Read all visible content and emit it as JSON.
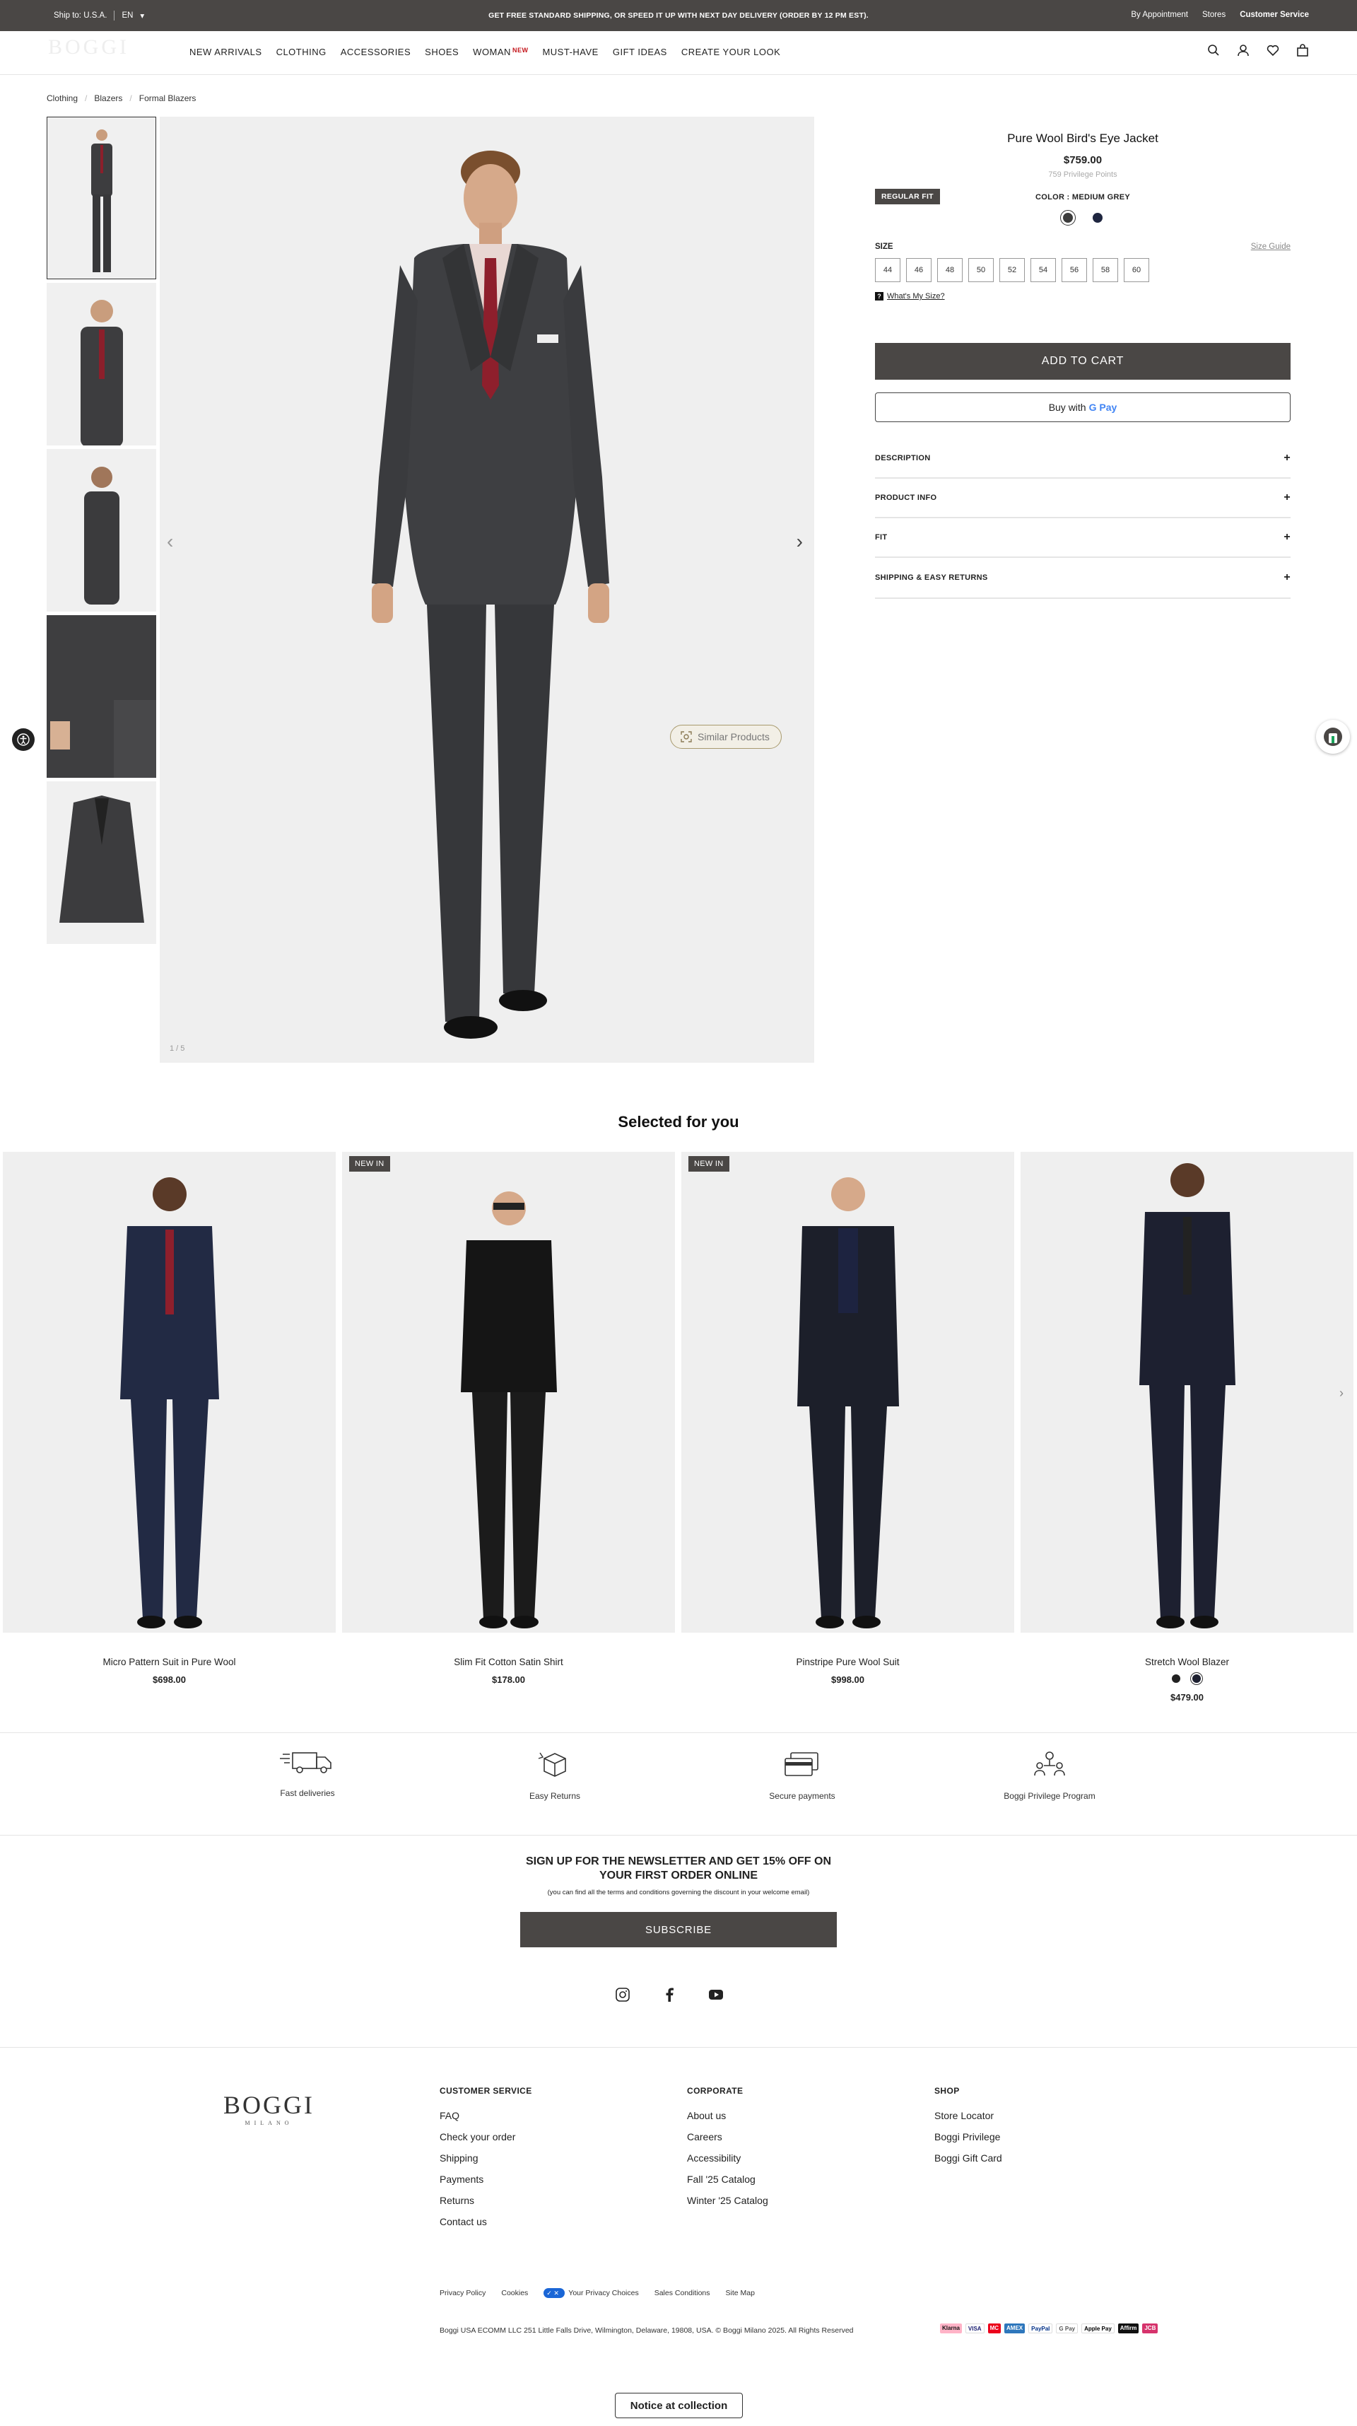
{
  "topbar": {
    "ship_to": "Ship to: U.S.A.",
    "language": "EN",
    "promo": "GET FREE STANDARD SHIPPING, OR SPEED IT UP WITH NEXT DAY DELIVERY (ORDER BY 12 PM EST).",
    "by_appointment": "By Appointment",
    "stores": "Stores",
    "customer_service": "Customer Service"
  },
  "nav": {
    "logo": "BOGGI",
    "items": [
      "NEW ARRIVALS",
      "CLOTHING",
      "ACCESSORIES",
      "SHOES",
      "WOMAN",
      "MUST-HAVE",
      "GIFT IDEAS",
      "CREATE YOUR LOOK"
    ],
    "woman_badge": "NEW",
    "icons": [
      "search-icon",
      "account-icon",
      "wishlist-icon",
      "bag-icon"
    ]
  },
  "breadcrumb": [
    "Clothing",
    "Blazers",
    "Formal Blazers"
  ],
  "gallery": {
    "counter": "1 / 5",
    "similar_products": "Similar Products"
  },
  "product": {
    "title": "Pure Wool Bird's Eye Jacket",
    "price": "$759.00",
    "points": "759 Privilege Points",
    "fit": "REGULAR FIT",
    "color_label": "COLOR : MEDIUM GREY",
    "swatches": [
      "#3c3c3c",
      "#1f2640"
    ],
    "size_label": "SIZE",
    "size_guide": "Size Guide",
    "sizes": [
      "44",
      "46",
      "48",
      "50",
      "52",
      "54",
      "56",
      "58",
      "60"
    ],
    "whats_my_size": "What's My Size?",
    "add_to_cart": "ADD TO CART",
    "buy_with": "Buy with",
    "gpay": "G Pay",
    "accordion": [
      "DESCRIPTION",
      "PRODUCT INFO",
      "FIT",
      "SHIPPING & EASY RETURNS"
    ]
  },
  "recommendations": {
    "title": "Selected for you",
    "items": [
      {
        "name": "Micro Pattern Suit in Pure Wool",
        "price": "$698.00",
        "badge": ""
      },
      {
        "name": "Slim Fit Cotton Satin Shirt",
        "price": "$178.00",
        "badge": "NEW IN"
      },
      {
        "name": "Pinstripe Pure Wool Suit",
        "price": "$998.00",
        "badge": "NEW IN"
      },
      {
        "name": "Stretch Wool Blazer",
        "price": "$479.00",
        "badge": ""
      }
    ]
  },
  "benefits": [
    "Fast deliveries",
    "Easy Returns",
    "Secure payments",
    "Boggi Privilege Program"
  ],
  "newsletter": {
    "heading_line1": "SIGN UP FOR THE NEWSLETTER AND GET 15% OFF ON",
    "heading_line2": "YOUR FIRST ORDER ONLINE",
    "subtext": "(you can find all the terms and conditions governing the discount in your welcome email)",
    "button": "SUBSCRIBE"
  },
  "footer": {
    "logo": "BOGGI",
    "logo_sub": "MILANO",
    "customer_service": {
      "title": "CUSTOMER SERVICE",
      "links": [
        "FAQ",
        "Check your order",
        "Shipping",
        "Payments",
        "Returns",
        "Contact us"
      ]
    },
    "corporate": {
      "title": "CORPORATE",
      "links": [
        "About us",
        "Careers",
        "Accessibility",
        "Fall '25 Catalog",
        "Winter '25 Catalog"
      ]
    },
    "shop": {
      "title": "SHOP",
      "links": [
        "Store Locator",
        "Boggi Privilege",
        "Boggi Gift Card"
      ]
    },
    "legal": [
      "Privacy Policy",
      "Cookies",
      "Your Privacy Choices",
      "Sales Conditions",
      "Site Map"
    ],
    "address": "Boggi USA ECOMM LLC 251 Little Falls Drive, Wilmington, Delaware, 19808, USA. © Boggi Milano 2025. All Rights Reserved",
    "payments": [
      "Klarna",
      "VISA",
      "MC",
      "AMEX",
      "PayPal",
      "G Pay",
      "Apple Pay",
      "Affirm",
      "JCB"
    ]
  },
  "notice": "Notice at collection",
  "colors": {
    "brand_dark": "#4a4745",
    "accent_red": "#c4161c"
  }
}
